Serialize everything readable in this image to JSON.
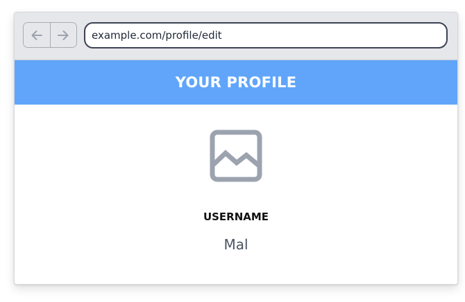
{
  "browser": {
    "back_icon": "arrow-left-icon",
    "forward_icon": "arrow-right-icon",
    "url": "example.com/profile/edit"
  },
  "header": {
    "title": "YOUR PROFILE"
  },
  "profile": {
    "avatar_icon": "image-placeholder-icon",
    "username_label": "USERNAME",
    "username_value": "Mal"
  },
  "colors": {
    "header_bg": "#60a5fa",
    "toolbar_bg": "#e5e7eb",
    "icon_gray": "#9ca3af"
  }
}
